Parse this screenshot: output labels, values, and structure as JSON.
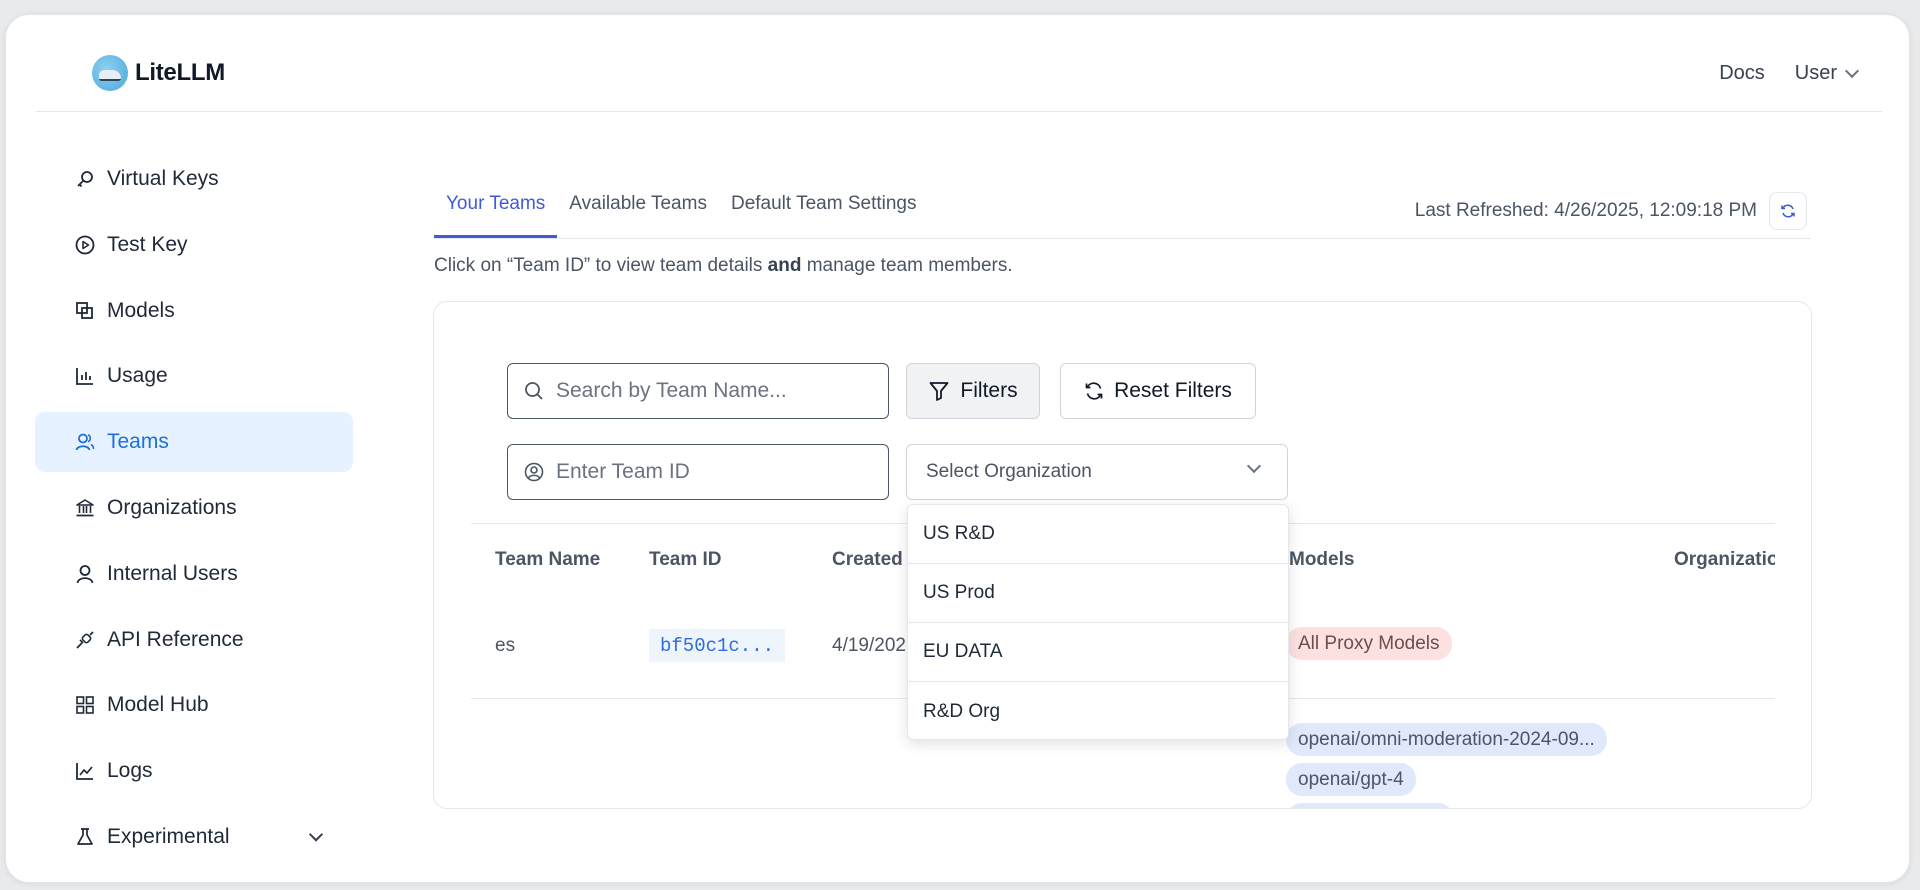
{
  "header": {
    "logo_text": "LiteLLM",
    "docs_label": "Docs",
    "user_label": "User"
  },
  "sidebar": {
    "items": [
      {
        "label": "Virtual Keys",
        "icon": "key-icon"
      },
      {
        "label": "Test Key",
        "icon": "play-circle-icon"
      },
      {
        "label": "Models",
        "icon": "block-icon"
      },
      {
        "label": "Usage",
        "icon": "bar-chart-icon"
      },
      {
        "label": "Teams",
        "icon": "team-icon",
        "active": true
      },
      {
        "label": "Organizations",
        "icon": "bank-icon"
      },
      {
        "label": "Internal Users",
        "icon": "user-icon"
      },
      {
        "label": "API Reference",
        "icon": "api-icon"
      },
      {
        "label": "Model Hub",
        "icon": "appstore-icon"
      },
      {
        "label": "Logs",
        "icon": "line-chart-icon"
      },
      {
        "label": "Experimental",
        "icon": "experiment-icon"
      }
    ]
  },
  "tabs": [
    {
      "label": "Your Teams",
      "active": true
    },
    {
      "label": "Available Teams"
    },
    {
      "label": "Default Team Settings"
    }
  ],
  "last_refreshed": "Last Refreshed: 4/26/2025, 12:09:18 PM",
  "help": {
    "part1": "Click on “Team ID” to view team details ",
    "bold": "and",
    "part2": " manage team members."
  },
  "filters": {
    "search_placeholder": "Search by Team Name...",
    "team_id_placeholder": "Enter Team ID",
    "filters_label": "Filters",
    "reset_label": "Reset Filters",
    "org_placeholder": "Select Organization",
    "org_options": [
      "US R&D",
      "US Prod",
      "EU DATA",
      "R&D Org"
    ]
  },
  "table": {
    "headers": [
      "Team Name",
      "Team ID",
      "Created",
      "Models",
      "Organizatio"
    ],
    "rows": [
      {
        "team_name": "es",
        "team_id": "bf50c1c...",
        "created": "4/19/202",
        "models": [
          "All Proxy Models"
        ]
      },
      {
        "models": [
          "openai/omni-moderation-2024-09...",
          "openai/gpt-4"
        ]
      }
    ]
  },
  "colors": {
    "accent": "#3e5cd8",
    "active_nav_bg": "#e6f2ff",
    "active_nav_text": "#1e6fd9",
    "chip_red": "#fde1e1",
    "chip_blue": "#dfe9fb"
  }
}
